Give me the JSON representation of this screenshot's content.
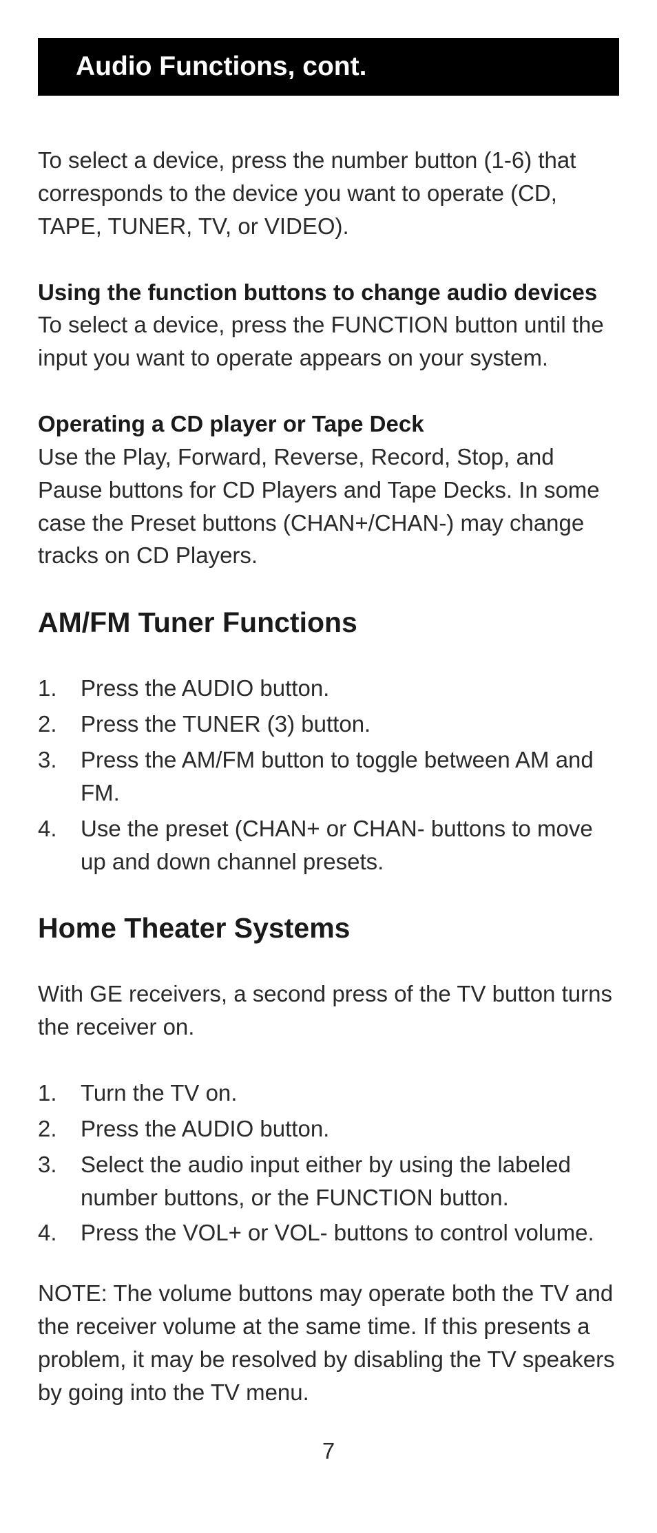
{
  "header": {
    "title": "Audio Functions, cont."
  },
  "intro": {
    "text": "To select a device, press the number button (1-6)  that corresponds to the device you want to operate (CD, TAPE, TUNER, TV, or VIDEO)."
  },
  "section1": {
    "heading": "Using the function buttons to change audio devices",
    "text": "To select a device, press the FUNCTION button until the input you want to operate appears on your system."
  },
  "section2": {
    "heading": "Operating a CD player or Tape Deck",
    "text": "Use the Play, Forward, Reverse, Record, Stop, and Pause buttons for CD Players and Tape Decks. In some case the Preset buttons (CHAN+/CHAN-) may change tracks on CD Players."
  },
  "tuner": {
    "heading": "AM/FM Tuner Functions",
    "steps": [
      "Press the AUDIO button.",
      "Press the TUNER (3) button.",
      "Press the AM/FM button to toggle between AM and FM.",
      "Use the preset (CHAN+  or CHAN- buttons to move up and down channel presets."
    ]
  },
  "home_theater": {
    "heading": "Home Theater Systems",
    "intro": "With GE receivers, a second press of the TV button turns the receiver on.",
    "steps": [
      "Turn the TV on.",
      "Press the AUDIO button.",
      "Select the audio input either by using the labeled number buttons, or the FUNCTION button.",
      "Press the VOL+ or VOL- buttons to control volume."
    ],
    "note": "NOTE: The volume buttons may operate both the TV and the receiver volume at the same time. If this presents a problem, it may be resolved by disabling the TV speakers by going into the TV menu."
  },
  "page_number": "7"
}
